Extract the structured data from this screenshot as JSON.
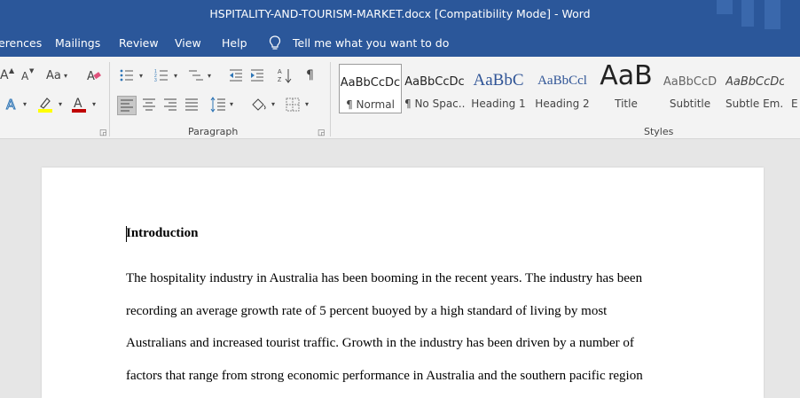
{
  "window": {
    "title": "HSPITALITY-AND-TOURISM-MARKET.docx [Compatibility Mode]  -  Word"
  },
  "menu": {
    "items": [
      "erences",
      "Mailings",
      "Review",
      "View",
      "Help"
    ],
    "tell_me": "Tell me what you want to do"
  },
  "ribbon": {
    "font_group": {
      "grow_font": "A",
      "shrink_font": "A",
      "change_case": "Aa",
      "text_effects": "A",
      "font_color": "A"
    },
    "paragraph_label": "Paragraph",
    "styles_label": "Styles",
    "styles": [
      {
        "sample": "AaBbCcDc",
        "name": "¶ Normal"
      },
      {
        "sample": "AaBbCcDc",
        "name": "¶ No Spac..."
      },
      {
        "sample": "AaBbC",
        "name": "Heading 1"
      },
      {
        "sample": "AaBbCcl",
        "name": "Heading 2"
      },
      {
        "sample": "AaB",
        "name": "Title"
      },
      {
        "sample": "AaBbCcD",
        "name": "Subtitle"
      },
      {
        "sample": "AaBbCcDc",
        "name": "Subtle Em..."
      },
      {
        "sample": "",
        "name": "E"
      }
    ],
    "colors": {
      "highlight": "#ffff00",
      "font_color": "#c00000",
      "text_effects": "#2e75b6"
    }
  },
  "document": {
    "heading": "Introduction",
    "lines": [
      "The hospitality industry in Australia has been booming in the recent years. The industry has been",
      "recording an average growth rate of 5 percent buoyed by a high standard of living by most",
      "Australians and increased tourist traffic. Growth in the industry has been driven by a number of",
      "factors that range from strong economic performance in Australia and the southern pacific region"
    ]
  },
  "theme": {
    "title_bar": "#2b579a",
    "ribbon_bg": "#f3f3f3",
    "canvas_bg": "#e6e6e6"
  }
}
